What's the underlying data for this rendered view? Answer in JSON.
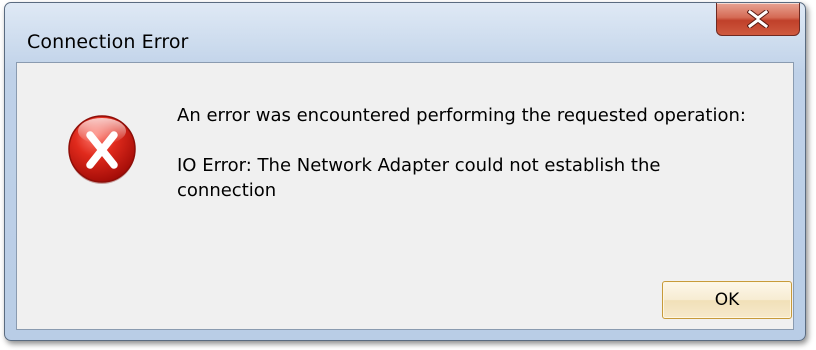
{
  "dialog": {
    "title": "Connection Error",
    "message_line1": "An error was encountered performing the requested operation:",
    "message_line2": "IO Error: The Network Adapter could not establish the connection",
    "ok_label": "OK",
    "close_label": "X",
    "icon": "error-icon",
    "colors": {
      "close_button": "#c9503a",
      "error_icon": "#d8201e",
      "client_bg": "#f0f0f0",
      "ok_border": "#c79a3a"
    }
  }
}
